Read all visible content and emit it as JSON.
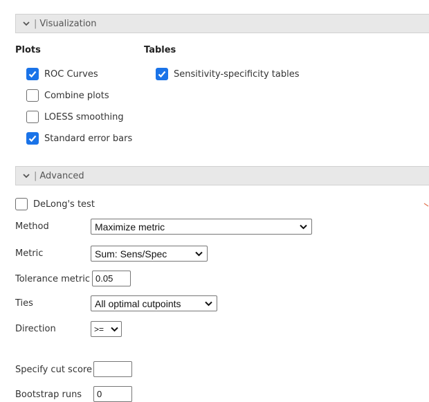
{
  "visualization": {
    "header": "Visualization",
    "plots": {
      "heading": "Plots",
      "items": [
        {
          "label": "ROC Curves",
          "checked": true
        },
        {
          "label": "Combine plots",
          "checked": false
        },
        {
          "label": "LOESS smoothing",
          "checked": false
        },
        {
          "label": "Standard error bars",
          "checked": true
        }
      ]
    },
    "tables": {
      "heading": "Tables",
      "items": [
        {
          "label": "Sensitivity-specificity tables",
          "checked": true
        }
      ]
    }
  },
  "advanced": {
    "header": "Advanced",
    "delong": {
      "label": "DeLong's test",
      "checked": false
    },
    "method": {
      "label": "Method",
      "value": "Maximize metric"
    },
    "metric": {
      "label": "Metric",
      "value": "Sum: Sens/Spec"
    },
    "tolerance": {
      "label": "Tolerance metric",
      "value": "0.05"
    },
    "ties": {
      "label": "Ties",
      "value": "All optimal cutpoints"
    },
    "direction": {
      "label": "Direction",
      "value": ">="
    },
    "cut_score": {
      "label": "Specify cut score",
      "value": ""
    },
    "bootstrap": {
      "label": "Bootstrap runs",
      "value": "0"
    }
  },
  "colors": {
    "checkbox_checked": "#1a73e8",
    "header_bg": "#e8e8e8"
  }
}
